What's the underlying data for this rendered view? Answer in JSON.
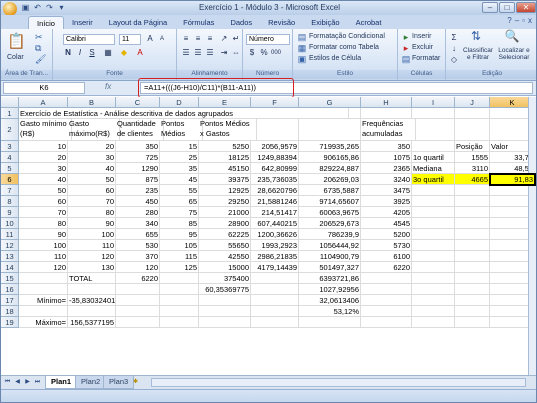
{
  "window": {
    "title": "Exercício 1 - Módulo 3 - Microsoft Excel"
  },
  "tabs": [
    "Início",
    "Inserir",
    "Layout da Página",
    "Fórmulas",
    "Dados",
    "Revisão",
    "Exibição",
    "Acrobat"
  ],
  "ribbon": {
    "clipboard": {
      "label": "Área de Tran...",
      "paste": "Colar"
    },
    "font": {
      "label": "Fonte",
      "name": "Calibri",
      "size": "11",
      "bold": "N",
      "italic": "I",
      "underline": "S"
    },
    "alignment": {
      "label": "Alinhamento"
    },
    "number": {
      "label": "Número",
      "format": "Número",
      "percent": "%",
      "thousands": "000"
    },
    "styles": {
      "label": "Estilo",
      "conditional": "Formatação Condicional",
      "table": "Formatar como Tabela",
      "cell_styles": "Estilos de Célula"
    },
    "cells": {
      "label": "Células",
      "insert": "Inserir",
      "delete": "Excluir",
      "format": "Formatar"
    },
    "editing": {
      "label": "Edição",
      "sort": "Classificar e Filtrar",
      "find": "Localizar e Selecionar"
    }
  },
  "formula_bar": {
    "name_box": "K6",
    "fx": "fx",
    "formula": "=A11+(((J6-H10)/C11)*(B11-A11))"
  },
  "columns": [
    "A",
    "B",
    "C",
    "D",
    "E",
    "F",
    "G",
    "H",
    "I",
    "J",
    "K"
  ],
  "rows": [
    "1",
    "2",
    "3",
    "4",
    "5",
    "6",
    "7",
    "8",
    "9",
    "10",
    "11",
    "12",
    "13",
    "14",
    "15",
    "16",
    "17",
    "18",
    "19"
  ],
  "cells": {
    "A1": "Exercício de Estatística - Análise descritiva de dados agrupados",
    "A2": "Gasto mínimo (R$)",
    "B2": "Gasto máximo(R$)",
    "C2": "Quantidade de clientes",
    "D2": "Pontos Médios",
    "E2": "Pontos Médios x Gastos",
    "H2": "Frequências acumuladas",
    "A3": "10",
    "B3": "20",
    "C3": "350",
    "D3": "15",
    "E3": "5250",
    "F3": "2056,9579",
    "G3": "719935,265",
    "H3": "350",
    "J3": "Posição",
    "K3": "Valor",
    "A4": "20",
    "B4": "30",
    "C4": "725",
    "D4": "25",
    "E4": "18125",
    "F4": "1249,88394",
    "G4": "906165,86",
    "H4": "1075",
    "I4": "1o quartil",
    "J4": "1555",
    "K4": "33,72",
    "A5": "30",
    "B5": "40",
    "C5": "1290",
    "D5": "35",
    "E5": "45150",
    "F5": "642,80999",
    "G5": "829224,887",
    "H5": "2365",
    "I5": "Mediana",
    "J5": "3110",
    "K5": "48,51",
    "A6": "40",
    "B6": "50",
    "C6": "875",
    "D6": "45",
    "E6": "39375",
    "F6": "235,736035",
    "G6": "206269,03",
    "H6": "3240",
    "I6": "3o quartil",
    "J6": "4665",
    "K6": "91,83",
    "A7": "50",
    "B7": "60",
    "C7": "235",
    "D7": "55",
    "E7": "12925",
    "F7": "28,6620796",
    "G7": "6735,5887",
    "H7": "3475",
    "A8": "60",
    "B8": "70",
    "C8": "450",
    "D8": "65",
    "E8": "29250",
    "F8": "21,5881246",
    "G8": "9714,65607",
    "H8": "3925",
    "A9": "70",
    "B9": "80",
    "C9": "280",
    "D9": "75",
    "E9": "21000",
    "F9": "214,51417",
    "G9": "60063,9675",
    "H9": "4205",
    "A10": "80",
    "B10": "90",
    "C10": "340",
    "D10": "85",
    "E10": "28900",
    "F10": "607,440215",
    "G10": "206529,673",
    "H10": "4545",
    "A11": "90",
    "B11": "100",
    "C11": "655",
    "D11": "95",
    "E11": "62225",
    "F11": "1200,36626",
    "G11": "786239,9",
    "H11": "5200",
    "A12": "100",
    "B12": "110",
    "C12": "530",
    "D12": "105",
    "E12": "55650",
    "F12": "1993,2923",
    "G12": "1056444,92",
    "H12": "5730",
    "A13": "110",
    "B13": "120",
    "C13": "370",
    "D13": "115",
    "E13": "42550",
    "F13": "2986,21835",
    "G13": "1104900,79",
    "H13": "6100",
    "A14": "120",
    "B14": "130",
    "C14": "120",
    "D14": "125",
    "E14": "15000",
    "F14": "4179,14439",
    "G14": "501497,327",
    "H14": "6220",
    "B15": "TOTAL",
    "C15": "6220",
    "E15": "375400",
    "G15": "6393721,86",
    "E16": "60,35369775",
    "G16": "1027,92956",
    "A17": "Mínimo=",
    "B17": "-35,83032401",
    "G17": "32,0613406",
    "G18": "53,12%",
    "A19": "Máximo=",
    "B19": "156,5377195"
  },
  "sheets": [
    "Plan1",
    "Plan2",
    "Plan3"
  ],
  "colors": {
    "highlight": "#ffff00",
    "selection_border": "#000000",
    "annotation_box": "#d62020"
  }
}
